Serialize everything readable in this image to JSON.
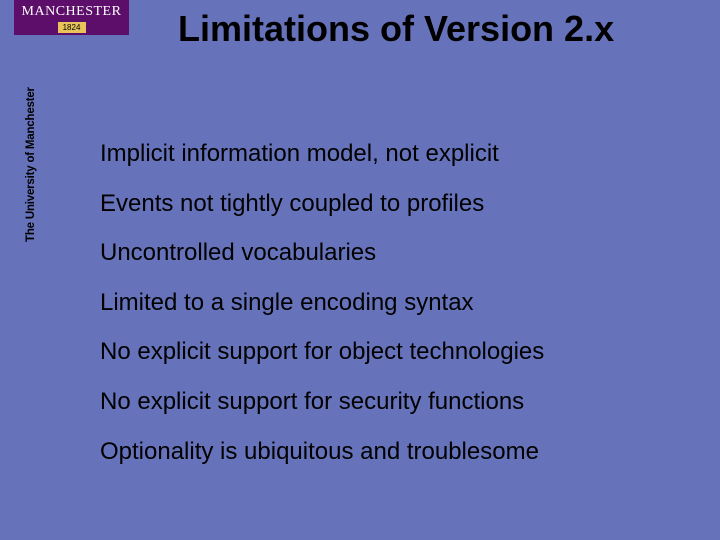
{
  "logo": {
    "name": "MANCHESTER",
    "year": "1824",
    "university": "The University of Manchester"
  },
  "title": "Limitations of Version 2.x",
  "bullets": [
    "Implicit information model, not explicit",
    "Events not tightly coupled to profiles",
    "Uncontrolled vocabularies",
    "Limited to a single encoding syntax",
    "No explicit support for object technologies",
    "No explicit support for security functions",
    "Optionality is ubiquitous and troublesome"
  ]
}
